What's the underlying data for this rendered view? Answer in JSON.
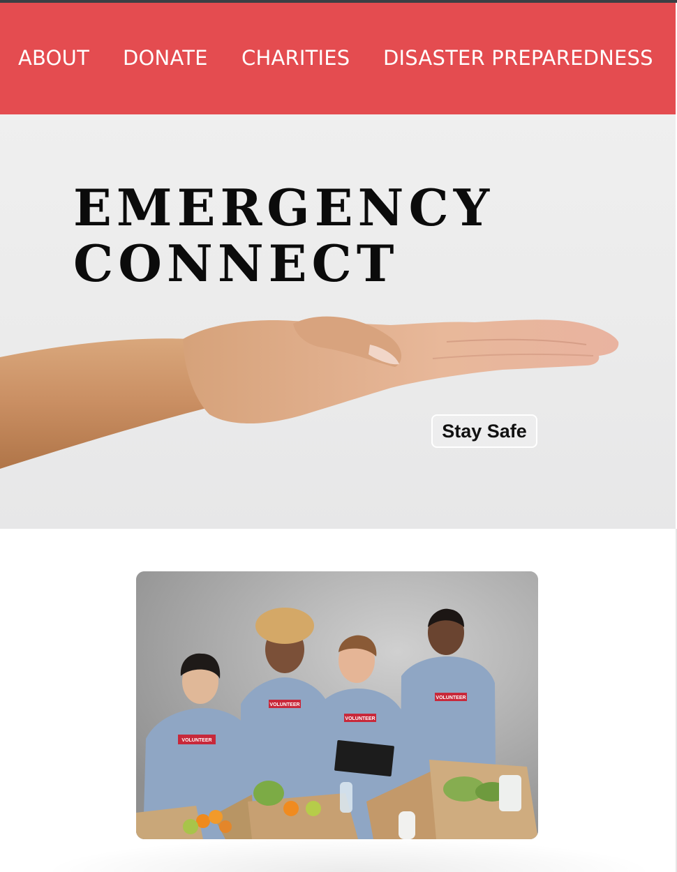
{
  "nav": {
    "about": "ABOUT",
    "donate": "DONATE",
    "charities": "CHARITIES",
    "disaster": "DISASTER PREPAREDNESS"
  },
  "hero": {
    "title_line1": "EMERGENCY",
    "title_line2": "CONNECT",
    "button_label": "Stay Safe"
  },
  "volunteers": {
    "badge_text": "VOLUNTEER"
  },
  "colors": {
    "nav_background": "#e44c50",
    "nav_text": "#ffffff",
    "hero_background": "#ededed",
    "title_text": "#0b0b0b",
    "shirt": "#8fa6c4",
    "badge": "#c8283a"
  },
  "icons": []
}
